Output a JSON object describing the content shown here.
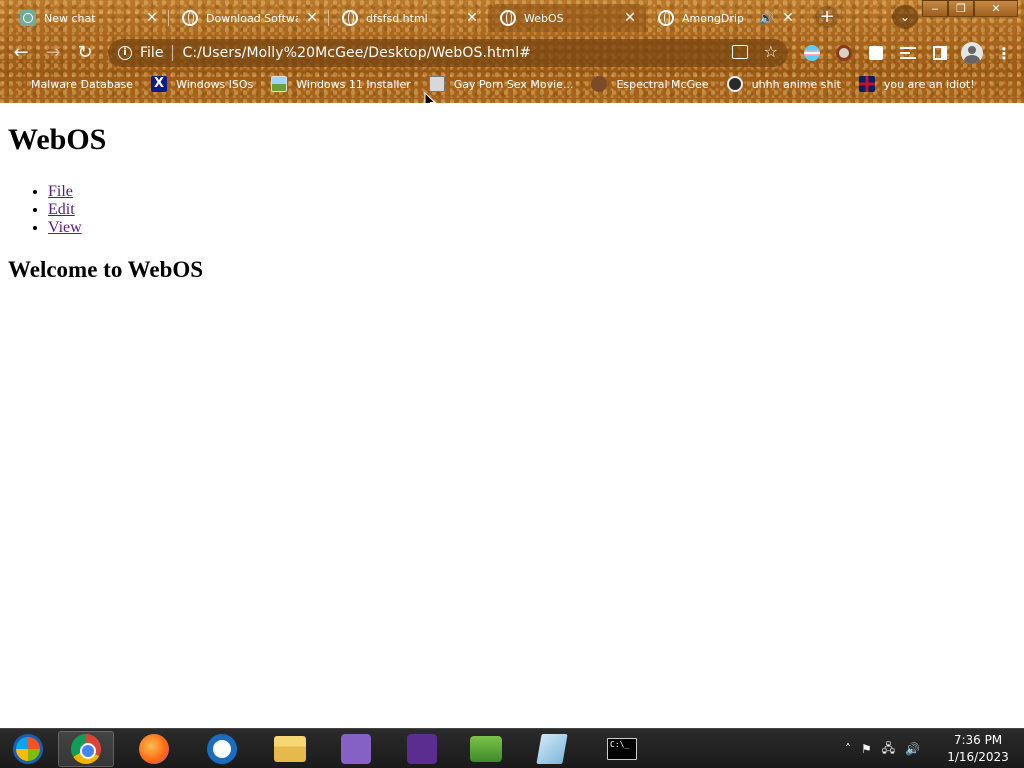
{
  "browser": {
    "tabs": [
      {
        "title": "New chat",
        "icon": "chatgpt-icon"
      },
      {
        "title": "Download Software",
        "icon": "globe-icon"
      },
      {
        "title": "dfsfsd.html",
        "icon": "globe-icon"
      },
      {
        "title": "WebOS",
        "icon": "globe-icon",
        "active": true
      },
      {
        "title": "AmongDrip",
        "icon": "globe-icon",
        "audio": true
      }
    ],
    "omnibox": {
      "scheme": "File",
      "url": "C:/Users/Molly%20McGee/Desktop/WebOS.html#"
    },
    "bookmarks": [
      {
        "label": "Malware Database",
        "icon": "blank"
      },
      {
        "label": "Windows ISOs",
        "icon": "x-icon"
      },
      {
        "label": "Windows 11 Installer",
        "icon": "image-icon"
      },
      {
        "label": "Gay Porn Sex Movie...",
        "icon": "computer-icon"
      },
      {
        "label": "Espectral McGee",
        "icon": "portrait-icon"
      },
      {
        "label": "uhhh anime shit",
        "icon": "anime-icon"
      },
      {
        "label": "you are an idiot!",
        "icon": "uk-flag-icon"
      }
    ]
  },
  "page": {
    "heading": "WebOS",
    "menu": [
      "File",
      "Edit",
      "View"
    ],
    "subheading": "Welcome to WebOS"
  },
  "taskbar": {
    "time": "7:36 PM",
    "date": "1/16/2023",
    "cmd_prompt": "C:\\_"
  }
}
